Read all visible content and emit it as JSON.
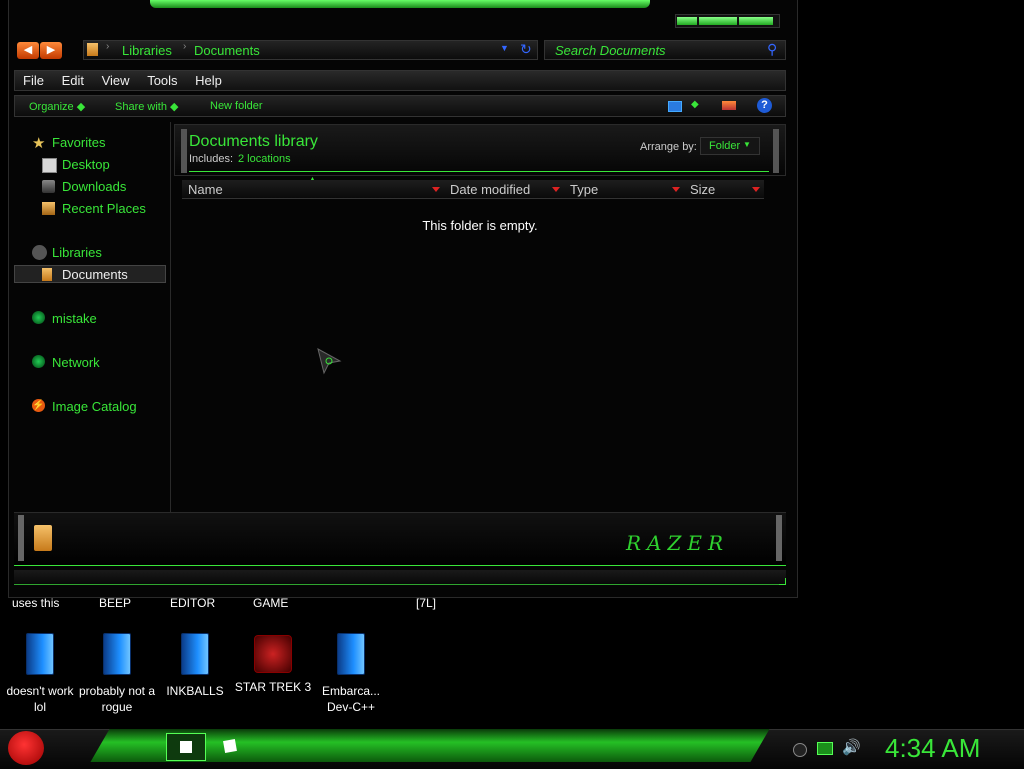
{
  "window": {
    "address": {
      "crumbs": [
        "Libraries",
        "Documents"
      ]
    },
    "search": {
      "placeholder": "Search Documents"
    },
    "menu": [
      "File",
      "Edit",
      "View",
      "Tools",
      "Help"
    ],
    "toolbar": {
      "organize": "Organize",
      "share_with": "Share with",
      "new_folder": "New folder"
    },
    "nav": {
      "favorites": "Favorites",
      "favorites_items": [
        "Desktop",
        "Downloads",
        "Recent Places"
      ],
      "libraries": "Libraries",
      "libraries_items": [
        "Documents"
      ],
      "homegroup": "mistake",
      "network": "Network",
      "image_catalog": "Image Catalog"
    },
    "library_header": {
      "title": "Documents library",
      "includes_label": "Includes:",
      "includes_value": "2 locations",
      "arrange_label": "Arrange by:",
      "arrange_value": "Folder"
    },
    "columns": [
      "Name",
      "Date modified",
      "Type",
      "Size"
    ],
    "empty_message": "This folder is empty.",
    "brand": "RAZER"
  },
  "desktop": {
    "partial_labels": [
      "uses this",
      "BEEP",
      "EDITOR",
      "GAME",
      "[7L]"
    ],
    "icons": [
      {
        "label": "doesn't work lol"
      },
      {
        "label": "probably not a rogue"
      },
      {
        "label": "INKBALLS"
      },
      {
        "label": "STAR TREK 3"
      },
      {
        "label": "Embarca... Dev-C++"
      }
    ]
  },
  "taskbar": {
    "clock": "4:34 AM"
  },
  "colors": {
    "accent": "#39e639",
    "orange": "#e85a10"
  }
}
